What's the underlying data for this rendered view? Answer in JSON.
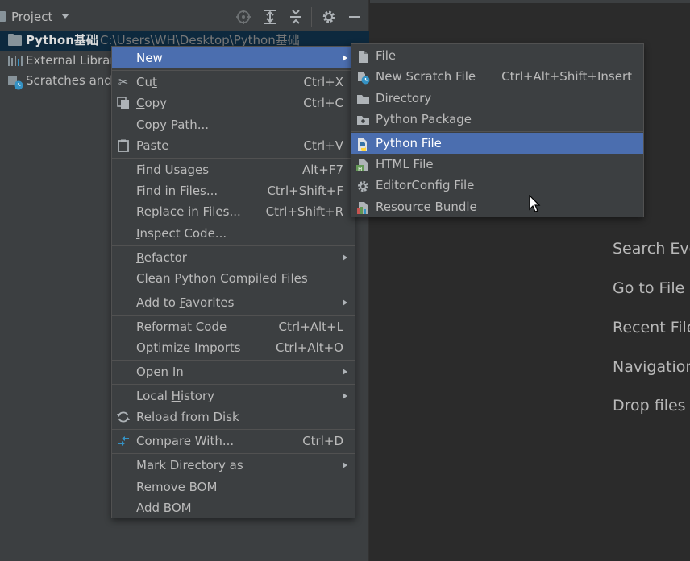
{
  "project_panel": {
    "title": "Project",
    "tree": {
      "root_name": "Python基础",
      "root_path": "C:\\Users\\WH\\Desktop\\Python基础",
      "external_libraries": "External Librari",
      "scratches": "Scratches and"
    }
  },
  "editor_hints": [
    "Search Eve",
    "Go to File",
    "Recent File",
    "Navigation",
    "Drop files"
  ],
  "context_menu": {
    "items": [
      {
        "label": "New",
        "shortcut": "",
        "submenu": true
      },
      {
        "label": "Cut",
        "shortcut": "Ctrl+X",
        "icon": "scissors-icon"
      },
      {
        "label": "Copy",
        "shortcut": "Ctrl+C",
        "icon": "copy-icon"
      },
      {
        "label": "Copy Path...",
        "shortcut": ""
      },
      {
        "label": "Paste",
        "shortcut": "Ctrl+V",
        "icon": "clipboard-icon"
      },
      {
        "label": "Find Usages",
        "shortcut": "Alt+F7"
      },
      {
        "label": "Find in Files...",
        "shortcut": "Ctrl+Shift+F"
      },
      {
        "label": "Replace in Files...",
        "shortcut": "Ctrl+Shift+R"
      },
      {
        "label": "Inspect Code...",
        "shortcut": ""
      },
      {
        "label": "Refactor",
        "shortcut": "",
        "submenu": true
      },
      {
        "label": "Clean Python Compiled Files",
        "shortcut": ""
      },
      {
        "label": "Add to Favorites",
        "shortcut": "",
        "submenu": true
      },
      {
        "label": "Reformat Code",
        "shortcut": "Ctrl+Alt+L"
      },
      {
        "label": "Optimize Imports",
        "shortcut": "Ctrl+Alt+O"
      },
      {
        "label": "Open In",
        "shortcut": "",
        "submenu": true
      },
      {
        "label": "Local History",
        "shortcut": "",
        "submenu": true
      },
      {
        "label": "Reload from Disk",
        "shortcut": "",
        "icon": "reload-icon"
      },
      {
        "label": "Compare With...",
        "shortcut": "Ctrl+D",
        "icon": "compare-icon"
      },
      {
        "label": "Mark Directory as",
        "shortcut": "",
        "submenu": true
      },
      {
        "label": "Remove BOM",
        "shortcut": ""
      },
      {
        "label": "Add BOM",
        "shortcut": ""
      }
    ]
  },
  "new_submenu": {
    "items": [
      {
        "label": "File",
        "shortcut": "",
        "icon": "file-icon"
      },
      {
        "label": "New Scratch File",
        "shortcut": "Ctrl+Alt+Shift+Insert",
        "icon": "scratch-file-icon"
      },
      {
        "label": "Directory",
        "shortcut": "",
        "icon": "folder-icon"
      },
      {
        "label": "Python Package",
        "shortcut": "",
        "icon": "package-icon"
      },
      {
        "label": "Python File",
        "shortcut": "",
        "icon": "python-icon",
        "selected": true
      },
      {
        "label": "HTML File",
        "shortcut": "",
        "icon": "html-file-icon"
      },
      {
        "label": "EditorConfig File",
        "shortcut": "",
        "icon": "gear-icon"
      },
      {
        "label": "Resource Bundle",
        "shortcut": "",
        "icon": "resource-bundle-icon"
      }
    ]
  },
  "colors": {
    "selection": "#4b6eaf",
    "menu_bg": "#3c3f41",
    "editor_bg": "#2b2b2b"
  }
}
